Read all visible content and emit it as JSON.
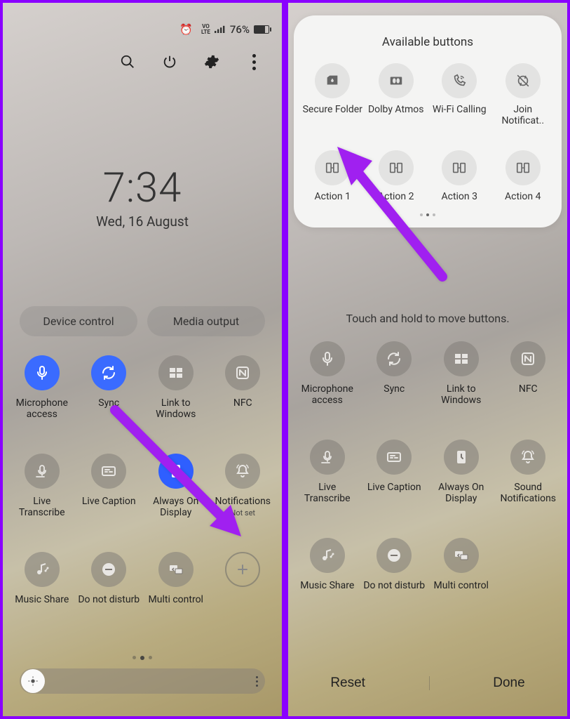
{
  "status": {
    "battery_pct": "76%"
  },
  "clock": {
    "time": "7:34",
    "date": "Wed, 16 August"
  },
  "chips": {
    "device_control": "Device control",
    "media_output": "Media output"
  },
  "tiles_left": [
    {
      "label": "Microphone access",
      "sub": ""
    },
    {
      "label": "Sync",
      "sub": ""
    },
    {
      "label": "Link to Windows",
      "sub": ""
    },
    {
      "label": "NFC",
      "sub": ""
    },
    {
      "label": "Live Transcribe",
      "sub": ""
    },
    {
      "label": "Live Caption",
      "sub": ""
    },
    {
      "label": "Always On Display",
      "sub": ""
    },
    {
      "label": "Notifications",
      "sub": "Not set"
    },
    {
      "label": "Music Share",
      "sub": ""
    },
    {
      "label": "Do not disturb",
      "sub": ""
    },
    {
      "label": "Multi control",
      "sub": ""
    }
  ],
  "panel": {
    "title": "Available buttons",
    "items": [
      {
        "label": "Secure Folder"
      },
      {
        "label": "Dolby Atmos"
      },
      {
        "label": "Wi-Fi Calling"
      },
      {
        "label": "Join Notificat.."
      },
      {
        "label": "Action 1"
      },
      {
        "label": "Action 2"
      },
      {
        "label": "Action 3"
      },
      {
        "label": "Action 4"
      }
    ]
  },
  "hint": "Touch and hold to move buttons.",
  "tiles_right": [
    {
      "label": "Microphone access"
    },
    {
      "label": "Sync"
    },
    {
      "label": "Link to Windows"
    },
    {
      "label": "NFC"
    },
    {
      "label": "Live Transcribe"
    },
    {
      "label": "Live Caption"
    },
    {
      "label": "Always On Display"
    },
    {
      "label": "Sound Notifications"
    },
    {
      "label": "Music Share"
    },
    {
      "label": "Do not disturb"
    },
    {
      "label": "Multi control"
    }
  ],
  "footer": {
    "reset": "Reset",
    "done": "Done"
  }
}
